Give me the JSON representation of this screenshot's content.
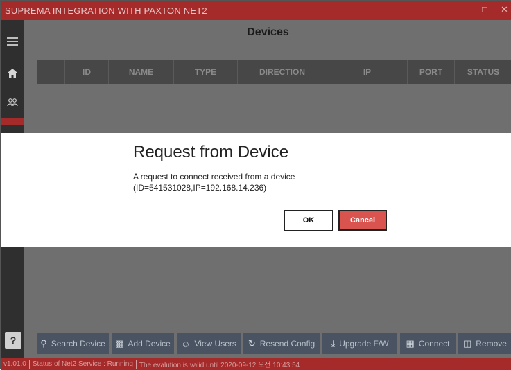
{
  "window": {
    "title": "SUPREMA INTEGRATION WITH PAXTON NET2",
    "controls": {
      "minimize": "–",
      "maximize": "□",
      "close": "✕"
    }
  },
  "sidebar": {
    "icons": [
      "menu-icon",
      "home-icon",
      "users-icon"
    ],
    "help": "?"
  },
  "page": {
    "title": "Devices"
  },
  "table": {
    "columns": [
      "ID",
      "NAME",
      "TYPE",
      "DIRECTION",
      "IP",
      "PORT",
      "STATUS"
    ]
  },
  "dialog": {
    "title": "Request from Device",
    "line1": "A request to connect received from a device",
    "line2": "(ID=541531028,IP=192.168.14.236)",
    "ok": "OK",
    "cancel": "Cancel"
  },
  "toolbar": {
    "search": "Search Device",
    "add": "Add Device",
    "view_users": "View Users",
    "resend": "Resend Config",
    "upgrade": "Upgrade F/W",
    "connect": "Connect",
    "remove": "Remove"
  },
  "status": {
    "version": "v1.01.0",
    "service": "Status of Net2 Service : Running",
    "validity": "The evalution is valid until 2020-09-12 오전 10:43:54"
  }
}
